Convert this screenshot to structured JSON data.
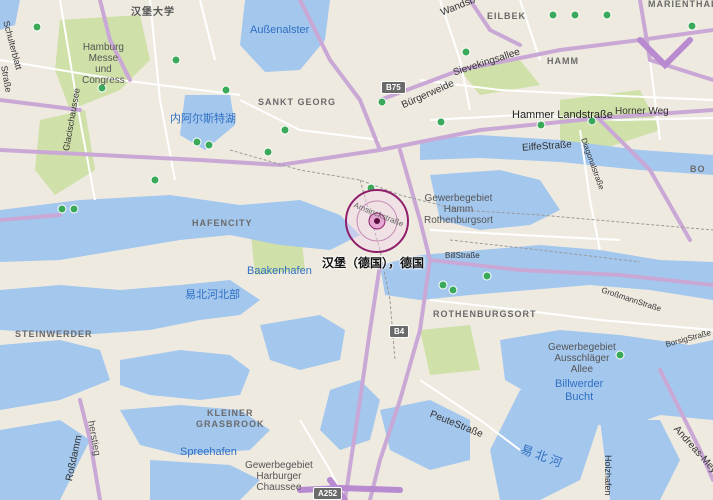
{
  "map": {
    "location_label": "汉堡（德国），德国",
    "route_shields": [
      "B75",
      "B4",
      "A252"
    ],
    "water_labels": {
      "aussenalster": "Außenalster",
      "binnenalster": "内阿尔斯特湖",
      "baakenhafen": "Baakenhafen",
      "spreehafen": "Spreehafen",
      "billwerder_bucht": "Billwerder\nBucht",
      "elbe_north": "易北河北部",
      "elbe_south": "易 北 河"
    },
    "districts": {
      "hafencity": "HAFENCITY",
      "sankt_georg": "SANKT GEORG",
      "eilbek": "EILBEK",
      "hamm": "HAMM",
      "steinwerder": "STEINWERDER",
      "rothenburgsort": "ROTHENBURGSORT",
      "kleiner_grasbrook": "KLEINER\nGRASBROOK",
      "marienthal": "MARIENTHAL",
      "bo": "BO"
    },
    "places": {
      "hamburg_messe": "Hamburg\nMesse\nund\nCongress",
      "gewerbegebiet_hamm": "Gewerbegebiet\nHamm\nRothenburgsort",
      "gewerbegebiet_ausschlager": "Gewerbegebiet\nAusschläger\nAllee",
      "gewerbegebiet_harburger": "Gewerbegebiet\nHarburger\nChaussee",
      "university": "汉堡大学"
    },
    "streets": {
      "wandsbeker": "Wandsb",
      "sievekingsallee": "Sievekingsallee",
      "buergerweide": "Bürgerweide",
      "hammer_landstrasse": "Hammer Landstraße",
      "horner_weg": "Horner Weg",
      "eiffestrasse": "EiffeStraße",
      "diagonalstrasse": "Diagonalstraße",
      "billstrasse": "BillStraße",
      "grossmannstrasse": "GroßmannStraße",
      "borsigstrasse": "BorsigStraße",
      "peutestrasse": "PeuteStraße",
      "rossdamm": "Roßdamm",
      "holzhafen": "Holzhafen",
      "andreas_meyer": "Andreas-Mey",
      "glacischaussee": "Glacischaussee",
      "schulterblatt": "Schulterblatt",
      "strasse_left": "Straße",
      "reiherstieg": "herstieg",
      "amsinckstrasse": "Amsinckstraße"
    },
    "colors": {
      "land": "#efeae0",
      "water": "#a4c7ee",
      "park": "#cfe0a8",
      "highway": "#c9a8d6",
      "pin": "#8f1f6b"
    }
  }
}
